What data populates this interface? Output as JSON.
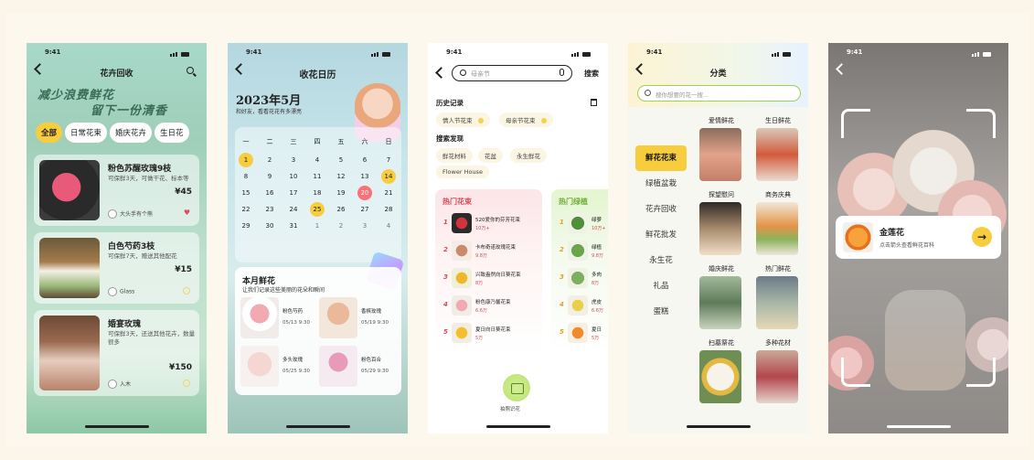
{
  "status_time": "9:41",
  "screen1": {
    "title": "花卉回收",
    "slogan_line1": "减少浪费鲜花",
    "slogan_line2": "留下一份清香",
    "tabs": [
      "全部",
      "日常花束",
      "婚庆花卉",
      "生日花"
    ],
    "items": [
      {
        "name": "粉色苏醒玫瑰9枝",
        "desc": "可保鲜3天，可做干花、标本等",
        "price": "¥45",
        "seller": "大头手有个熊",
        "liked": true
      },
      {
        "name": "白色芍药3枝",
        "desc": "可保鲜7天，赠送其他配花",
        "price": "¥15",
        "seller": "Glass",
        "liked": false
      },
      {
        "name": "婚宴玫瑰",
        "desc": "可保鲜3天，还送其他花卉，数量很多",
        "price": "¥150",
        "seller": "入木",
        "liked": false
      }
    ]
  },
  "screen2": {
    "title": "收花日历",
    "month": "2023年5月",
    "subtitle": "和好友，看看花花有多漂亮",
    "weekdays": [
      "一",
      "二",
      "三",
      "四",
      "五",
      "六",
      "日"
    ],
    "weeks": [
      [
        "1",
        "2",
        "3",
        "4",
        "5",
        "6",
        "7"
      ],
      [
        "8",
        "9",
        "10",
        "11",
        "12",
        "13",
        "14"
      ],
      [
        "15",
        "16",
        "17",
        "18",
        "19",
        "20",
        "21"
      ],
      [
        "22",
        "23",
        "24",
        "25",
        "26",
        "27",
        "28"
      ],
      [
        "29",
        "30",
        "31",
        "1",
        "2",
        "3",
        "4"
      ]
    ],
    "panel_title": "本月鲜花",
    "panel_subtitle": "让我们记录这些美丽的花朵和瞬间",
    "flowers": [
      {
        "name": "粉色芍药",
        "date": "05/13 9:30"
      },
      {
        "name": "香槟玫瑰",
        "date": "05/19 9:30"
      },
      {
        "name": "多头玫瑰",
        "date": "05/25 9:30"
      },
      {
        "name": "粉色百合",
        "date": "05/29 9:30"
      }
    ]
  },
  "screen3": {
    "search_placeholder": "母亲节",
    "search_button": "搜索",
    "history_title": "历史记录",
    "history": [
      "情人节花束",
      "母亲节花束"
    ],
    "discover_title": "搜索发现",
    "discover": [
      "鲜花材料",
      "花盆",
      "永生鲜花",
      "Flower House"
    ],
    "hot_title": "热门花束",
    "hot": [
      {
        "name": "520爱你的芬芳花束",
        "heat": "10万+"
      },
      {
        "name": "卡布奇诺玫瑰花束",
        "heat": "9.8万"
      },
      {
        "name": "兴致盎然向日葵花束",
        "heat": "8万"
      },
      {
        "name": "粉色康乃馨花束",
        "heat": "6.6万"
      },
      {
        "name": "夏日向日葵花束",
        "heat": "5万"
      }
    ],
    "green_title": "热门绿植",
    "green": [
      {
        "name": "绿萝",
        "heat": "10万+"
      },
      {
        "name": "绿植",
        "heat": "9.8万"
      },
      {
        "name": "多肉",
        "heat": "8万"
      },
      {
        "name": "虎皮",
        "heat": "6.6万"
      },
      {
        "name": "夏日",
        "heat": "5万"
      }
    ],
    "recognize_label": "拍照识花"
  },
  "screen4": {
    "title": "分类",
    "search_placeholder": "搜你想要的花一搜...",
    "categories": [
      "鲜花花束",
      "绿植盆栽",
      "花卉回收",
      "鲜花批发",
      "永生花",
      "礼品",
      "蛋糕"
    ],
    "items": [
      "爱情鲜花",
      "生日鲜花",
      "探望慰问",
      "商务庆典",
      "婚庆鲜花",
      "热门鲜花",
      "扫墓祭花",
      "多种花材"
    ]
  },
  "screen5": {
    "flower_name": "金莲花",
    "hint": "点击箭头查看鲜花百科"
  }
}
